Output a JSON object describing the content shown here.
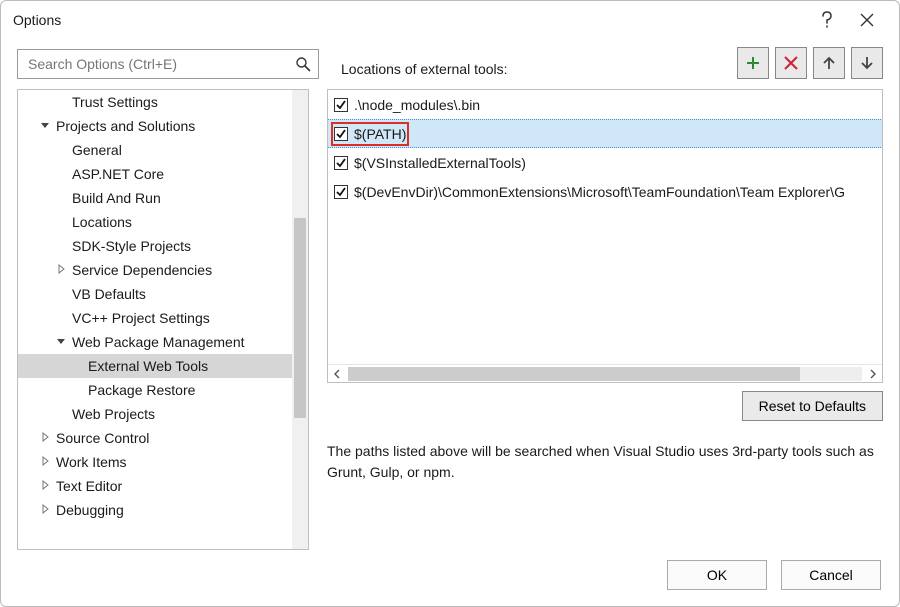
{
  "title": "Options",
  "search": {
    "placeholder": "Search Options (Ctrl+E)"
  },
  "tree": [
    {
      "label": "Trust Settings",
      "indent": 2,
      "exp": "none"
    },
    {
      "label": "Projects and Solutions",
      "indent": 1,
      "exp": "open"
    },
    {
      "label": "General",
      "indent": 2,
      "exp": "none"
    },
    {
      "label": "ASP.NET Core",
      "indent": 2,
      "exp": "none"
    },
    {
      "label": "Build And Run",
      "indent": 2,
      "exp": "none"
    },
    {
      "label": "Locations",
      "indent": 2,
      "exp": "none"
    },
    {
      "label": "SDK-Style Projects",
      "indent": 2,
      "exp": "none"
    },
    {
      "label": "Service Dependencies",
      "indent": 2,
      "exp": "closed"
    },
    {
      "label": "VB Defaults",
      "indent": 2,
      "exp": "none"
    },
    {
      "label": "VC++ Project Settings",
      "indent": 2,
      "exp": "none"
    },
    {
      "label": "Web Package Management",
      "indent": 2,
      "exp": "open"
    },
    {
      "label": "External Web Tools",
      "indent": 3,
      "exp": "none",
      "selected": true
    },
    {
      "label": "Package Restore",
      "indent": 3,
      "exp": "none"
    },
    {
      "label": "Web Projects",
      "indent": 2,
      "exp": "none"
    },
    {
      "label": "Source Control",
      "indent": 1,
      "exp": "closed"
    },
    {
      "label": "Work Items",
      "indent": 1,
      "exp": "closed"
    },
    {
      "label": "Text Editor",
      "indent": 1,
      "exp": "closed"
    },
    {
      "label": "Debugging",
      "indent": 1,
      "exp": "closed"
    }
  ],
  "right": {
    "label": "Locations of external tools:",
    "rows": [
      {
        "text": ".\\node_modules\\.bin",
        "checked": true
      },
      {
        "text": "$(PATH)",
        "checked": true,
        "selected": true,
        "highlighted": true
      },
      {
        "text": "$(VSInstalledExternalTools)",
        "checked": true
      },
      {
        "text": "$(DevEnvDir)\\CommonExtensions\\Microsoft\\TeamFoundation\\Team Explorer\\G",
        "checked": true
      }
    ],
    "reset": "Reset to Defaults",
    "desc": "The paths listed above will be searched when Visual Studio uses 3rd-party tools such as Grunt, Gulp, or npm."
  },
  "buttons": {
    "ok": "OK",
    "cancel": "Cancel"
  }
}
